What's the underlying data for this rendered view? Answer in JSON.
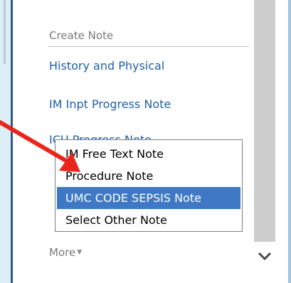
{
  "panel": {
    "header": "Create Note",
    "links": [
      "History and Physical",
      "IM Inpt Progress Note",
      "ICU Progress Note"
    ]
  },
  "dropdown": {
    "items": [
      {
        "label": "IM Free Text Note",
        "selected": false
      },
      {
        "label": "Procedure Note",
        "selected": false
      },
      {
        "label": "UMC CODE SEPSIS Note",
        "selected": true
      },
      {
        "label": "Select Other Note",
        "selected": false
      }
    ],
    "highlight_color": "#3f79c6"
  },
  "more": {
    "label": "More"
  },
  "annotation": {
    "icon": "red-arrow-icon",
    "color": "#e8261b"
  },
  "scrollbar": {
    "icon": "chevron-down-icon"
  }
}
